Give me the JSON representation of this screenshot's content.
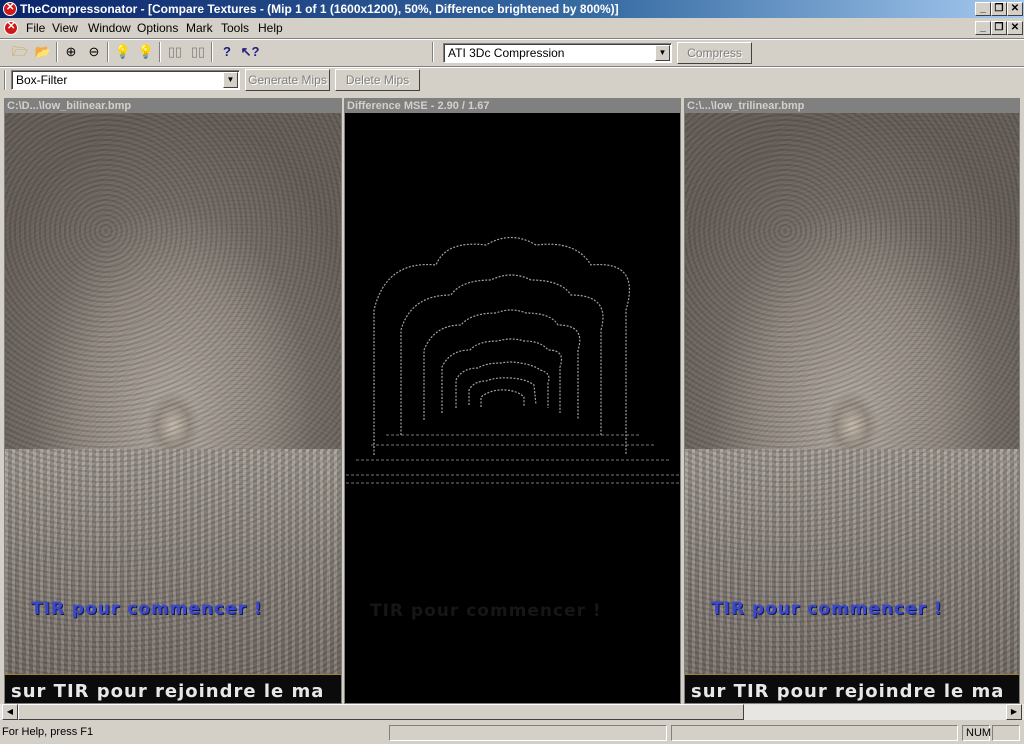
{
  "window": {
    "app_name": "TheCompressonator",
    "title": "TheCompressonator - [Compare Textures -  (Mip 1 of 1 (1600x1200), 50%, Difference brightened by 800%)]"
  },
  "menu": {
    "items": [
      {
        "label": "File"
      },
      {
        "label": "View"
      },
      {
        "label": "Window"
      },
      {
        "label": "Options"
      },
      {
        "label": "Mark"
      },
      {
        "label": "Tools"
      },
      {
        "label": "Help"
      }
    ]
  },
  "toolbar": {
    "compression_select": "ATI 3Dc Compression",
    "compress_label": "Compress",
    "filter_select": "Box-Filter",
    "generate_mips_label": "Generate Mips",
    "delete_mips_label": "Delete Mips",
    "icons": [
      "open-folder-icon",
      "open-file-icon",
      "zoom-in-icon",
      "zoom-out-icon",
      "bulb-on-icon",
      "bulb-off-icon",
      "mip-view-icon",
      "mip-compare-icon",
      "help-icon",
      "context-help-icon"
    ]
  },
  "panes": {
    "left": {
      "title": "C:\\D...\\low_bilinear.bmp",
      "message": "TIR pour commencer !",
      "marquee": "sur TIR pour rejoindre le ma"
    },
    "middle": {
      "title": "Difference MSE - 2.90 / 1.67",
      "message": "TIR pour commencer !"
    },
    "right": {
      "title": "C:\\...\\low_trilinear.bmp",
      "message": "TIR pour commencer !",
      "marquee": "sur TIR pour rejoindre le ma"
    }
  },
  "statusbar": {
    "help_text": "For Help, press F1",
    "num_indicator": "NUM"
  }
}
